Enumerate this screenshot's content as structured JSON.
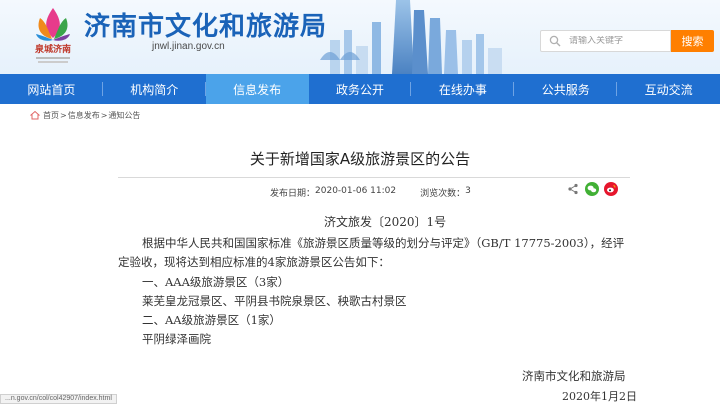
{
  "header": {
    "title": "济南市文化和旅游局",
    "domain": "jnwl.jinan.gov.cn",
    "logo_text": "泉城济南"
  },
  "search": {
    "placeholder": "请输入关键字",
    "button_label": "搜索"
  },
  "nav": {
    "items": [
      {
        "label": "网站首页"
      },
      {
        "label": "机构简介"
      },
      {
        "label": "信息发布"
      },
      {
        "label": "政务公开"
      },
      {
        "label": "在线办事"
      },
      {
        "label": "公共服务"
      },
      {
        "label": "互动交流"
      }
    ],
    "active_index": 2
  },
  "breadcrumb": {
    "items": [
      "首页",
      "信息发布",
      "通知公告"
    ],
    "separator": ">"
  },
  "article": {
    "title": "关于新增国家A级旅游景区的公告",
    "publish_label": "发布日期：",
    "publish_date": "2020-01-06  11:02",
    "views_label": "浏览次数：",
    "views": "3",
    "doc_number": "济文旅发〔2020〕1号",
    "paragraph1": "根据中华人民共和国国家标准《旅游景区质量等级的划分与评定》（GB/T 17775-2003），经评定验收，现将达到相应标准的4家旅游景区公告如下：",
    "line2": "一、AAA级旅游景区（3家）",
    "line3": "莱芜皇龙冠景区、平阴县书院泉景区、秧歌古村景区",
    "line4": "二、AA级旅游景区（1家）",
    "line5": "平阴绿泽画院",
    "signature_org": "济南市文化和旅游局",
    "signature_date": "2020年1月2日"
  },
  "status_bar": {
    "url": "...n.gov.cn/col/col42907/index.html"
  },
  "colors": {
    "brand_blue": "#1a63b8",
    "nav_blue": "#1f6fd0",
    "nav_active": "#4ba3ea",
    "search_orange": "#ff7f00"
  }
}
